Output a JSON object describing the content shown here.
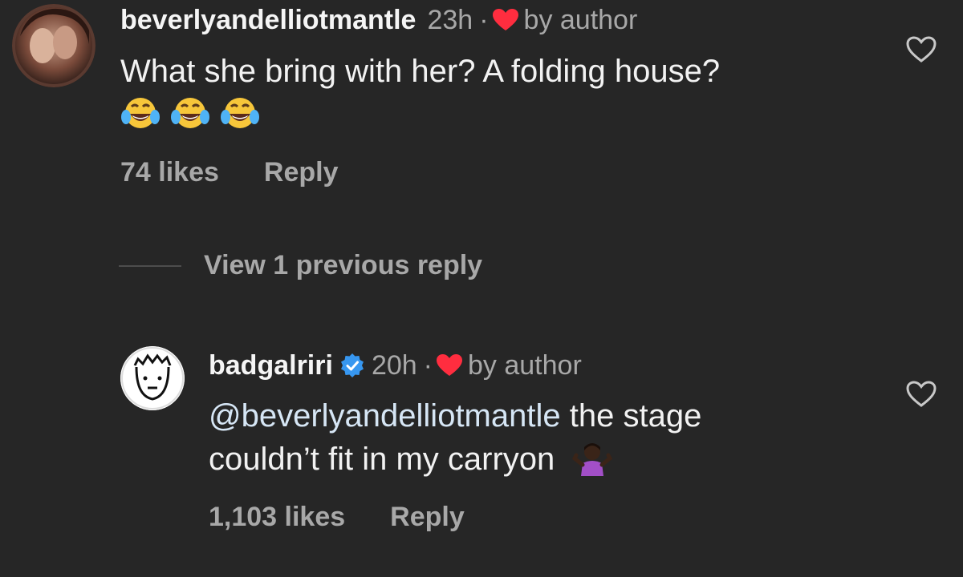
{
  "comments": [
    {
      "username": "beverlyandelliotmantle",
      "time": "23h",
      "separator": "·",
      "badge": "by author",
      "text": "What she bring with her? A folding house?",
      "emojis": [
        "face-with-tears-of-joy",
        "face-with-tears-of-joy",
        "face-with-tears-of-joy"
      ],
      "likes": "74 likes",
      "reply_label": "Reply"
    },
    {
      "username": "badgalriri",
      "verified": true,
      "time": "20h",
      "separator": "·",
      "badge": "by author",
      "mention": "@beverlyandelliotmantle",
      "text_line1_rest": " the stage",
      "text_line2": "couldn’t fit in my carryon",
      "emoji": "person-shrugging",
      "likes": "1,103 likes",
      "reply_label": "Reply"
    }
  ],
  "thread": {
    "view_replies_label": "View 1 previous reply"
  },
  "colors": {
    "background": "#262626",
    "primary_text": "#f5f5f5",
    "secondary_text": "#a8a8a8",
    "heart_red": "#ff2d3f",
    "verified_blue": "#3797f0"
  },
  "icons": [
    "heart-outline-icon",
    "heart-filled-icon",
    "verified-badge-icon"
  ]
}
